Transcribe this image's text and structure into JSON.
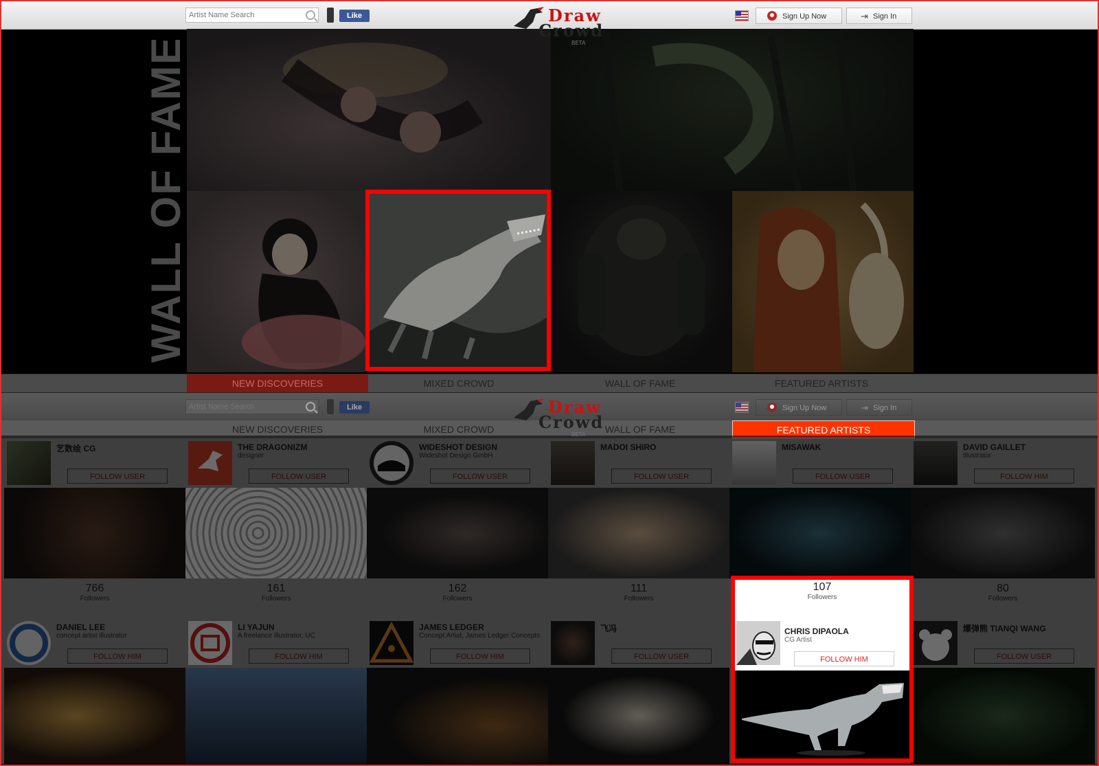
{
  "header": {
    "search_placeholder": "Artist Name Search",
    "fb_like": "Like",
    "logo_line1": "Draw",
    "logo_line2": "Crowd",
    "logo_beta": "BETA",
    "sign_up": "Sign Up Now",
    "sign_in": "Sign In"
  },
  "wall_of_fame_banner": "WALL OF FAME",
  "nav": [
    "NEW DISCOVERIES",
    "MIXED CROWD",
    "WALL OF FAME",
    "FEATURED ARTISTS"
  ],
  "artists_row1": [
    {
      "name": "艺数绘 CG",
      "role": "",
      "follow": "FOLLOW USER",
      "followers": "766"
    },
    {
      "name": "THE DRAGONIZM",
      "role": "designer",
      "follow": "FOLLOW USER",
      "followers": "161"
    },
    {
      "name": "WIDESHOT DESIGN",
      "role": "Wideshot Design GmbH",
      "follow": "FOLLOW USER",
      "followers": "162"
    },
    {
      "name": "MADOI SHIRO",
      "role": "",
      "follow": "FOLLOW USER",
      "followers": "111"
    },
    {
      "name": "MISAWAK",
      "role": "",
      "follow": "FOLLOW USER",
      "followers": "107"
    },
    {
      "name": "DAVID GAILLET",
      "role": "Illustrator",
      "follow": "FOLLOW HIM",
      "followers": "80"
    }
  ],
  "artists_row2": [
    {
      "name": "DANIEL LEE",
      "role": "concept artist illustrator",
      "follow": "FOLLOW HIM"
    },
    {
      "name": "LI YAJUN",
      "role": "A freelance illustrator, UC",
      "follow": "FOLLOW HIM"
    },
    {
      "name": "JAMES LEDGER",
      "role": "Concept Artist, James Ledger Concepts",
      "follow": "FOLLOW HIM"
    },
    {
      "name": "飞冯",
      "role": "",
      "follow": "FOLLOW USER"
    },
    {
      "name": "CHRIS DIPAOLA",
      "role": "CG Artist",
      "follow": "FOLLOW HIM"
    },
    {
      "name": "爆弹熊 TIANQI WANG",
      "role": "",
      "follow": "FOLLOW USER"
    }
  ],
  "followers_label": "Followers",
  "colors": {
    "accent": "#ff3300",
    "highlight": "#ff0000",
    "brand_red": "#cc1111"
  }
}
